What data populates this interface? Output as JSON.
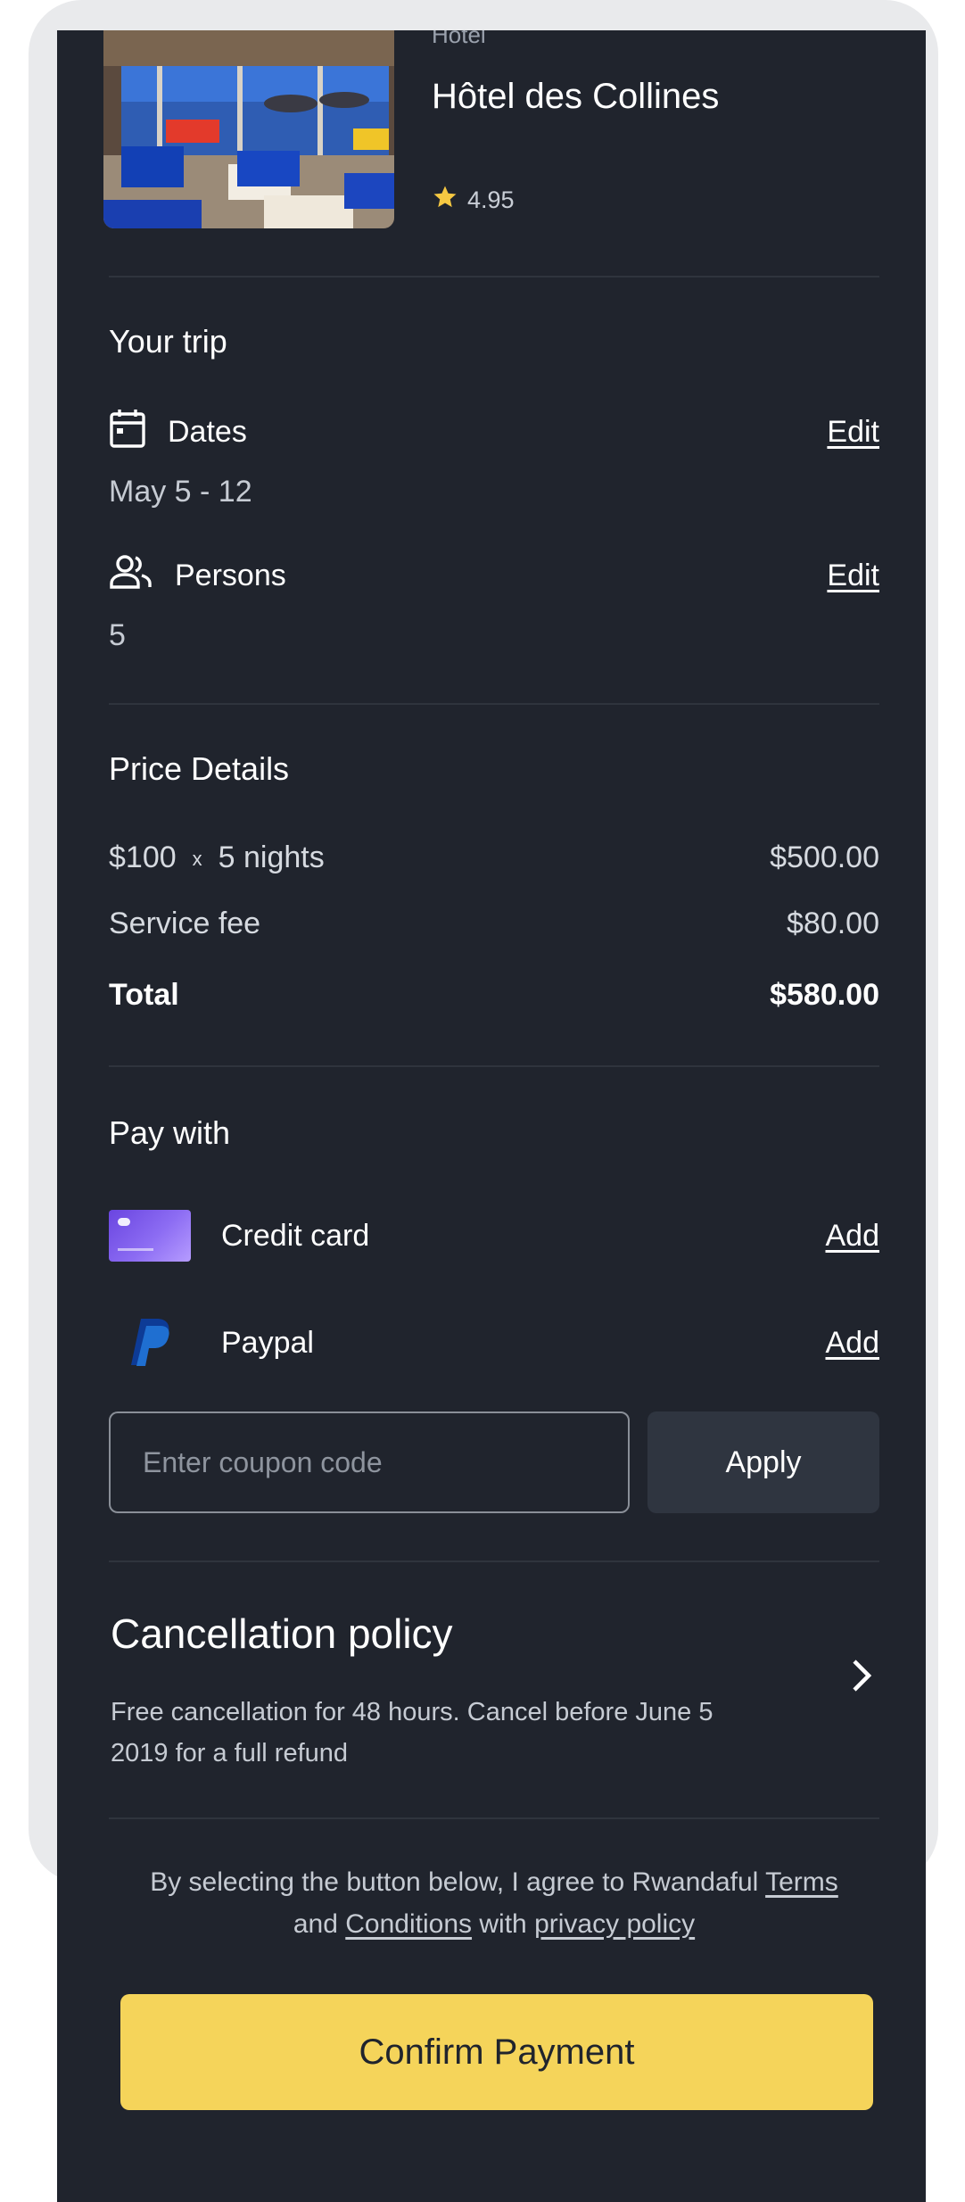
{
  "hotel": {
    "type_label": "Hotel",
    "name": "Hôtel des Collines",
    "rating": "4.95",
    "star_color": "#f5c842"
  },
  "trip": {
    "title": "Your trip",
    "dates_label": "Dates",
    "dates_value": "May 5 - 12",
    "dates_edit": "Edit",
    "persons_label": "Persons",
    "persons_value": "5",
    "persons_edit": "Edit"
  },
  "price": {
    "title": "Price Details",
    "rate": "$100",
    "multiplier": "x",
    "nights": "5 nights",
    "subtotal": "$500.00",
    "service_fee_label": "Service fee",
    "service_fee": "$80.00",
    "total_label": "Total",
    "total": "$580.00"
  },
  "payment": {
    "title": "Pay with",
    "methods": [
      {
        "label": "Credit card",
        "action": "Add",
        "icon": "credit-card-icon"
      },
      {
        "label": "Paypal",
        "action": "Add",
        "icon": "paypal-icon"
      }
    ],
    "coupon_placeholder": "Enter coupon code",
    "apply_label": "Apply"
  },
  "cancellation": {
    "title": "Cancellation policy",
    "text": "Free cancellation for 48 hours. Cancel before June 5 2019 for a full refund"
  },
  "agreement": {
    "prefix": "By selecting the button below, I agree to Rwandaful",
    "terms": "Terms",
    "and": "and",
    "conditions": "Conditions",
    "with": "with",
    "privacy": "privacy policy"
  },
  "confirm_label": "Confirm Payment",
  "colors": {
    "background": "#20242d",
    "accent": "#f5d45a",
    "divider": "#2f343d"
  }
}
